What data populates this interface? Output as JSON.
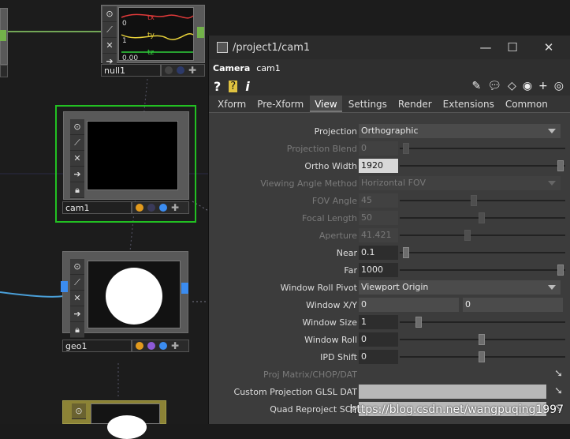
{
  "nodes": {
    "null1": {
      "label": "null1",
      "chans": [
        "tx",
        "ty",
        "tz"
      ],
      "vals": [
        "0",
        "1",
        "0.00"
      ]
    },
    "cam1": {
      "label": "cam1"
    },
    "geo1": {
      "label": "geo1"
    }
  },
  "panel": {
    "title": "/project1/cam1",
    "op_type": "Camera",
    "op_name": "cam1",
    "tabs": [
      "Xform",
      "Pre-Xform",
      "View",
      "Settings",
      "Render",
      "Extensions",
      "Common"
    ],
    "active_tab": "View",
    "params": {
      "projection": {
        "label": "Projection",
        "value": "Orthographic"
      },
      "projection_blend": {
        "label": "Projection Blend",
        "value": "0",
        "slider": 0.02
      },
      "ortho_width": {
        "label": "Ortho Width",
        "value": "1920",
        "slider": 1.0
      },
      "viewing_angle_method": {
        "label": "Viewing Angle Method",
        "value": "Horizontal FOV"
      },
      "fov_angle": {
        "label": "FOV Angle",
        "value": "45",
        "slider": 0.45
      },
      "focal_length": {
        "label": "Focal Length",
        "value": "50",
        "slider": 0.5
      },
      "aperture": {
        "label": "Aperture",
        "value": "41.421",
        "slider": 0.41
      },
      "near": {
        "label": "Near",
        "value": "0.1",
        "slider": 0.02
      },
      "far": {
        "label": "Far",
        "value": "1000",
        "slider": 1.0
      },
      "window_roll_pivot": {
        "label": "Window Roll Pivot",
        "value": "Viewport Origin"
      },
      "window_xy": {
        "label": "Window X/Y",
        "x": "0",
        "y": "0"
      },
      "window_size": {
        "label": "Window Size",
        "value": "1",
        "slider": 0.1
      },
      "window_roll": {
        "label": "Window Roll",
        "value": "0",
        "slider": 0.5
      },
      "ipd_shift": {
        "label": "IPD Shift",
        "value": "0",
        "slider": 0.5
      },
      "proj_matrix": {
        "label": "Proj Matrix/CHOP/DAT"
      },
      "custom_projection": {
        "label": "Custom Projection GLSL DAT",
        "value": ""
      },
      "quad_reproject": {
        "label": "Quad Reproject SOP",
        "value": ""
      }
    }
  },
  "watermark": "https://blog.csdn.net/wangpuqing1997",
  "colors": {
    "selected": "#22c022",
    "panel_bg": "#3c3c3c",
    "wire": "#4a9fd8"
  }
}
